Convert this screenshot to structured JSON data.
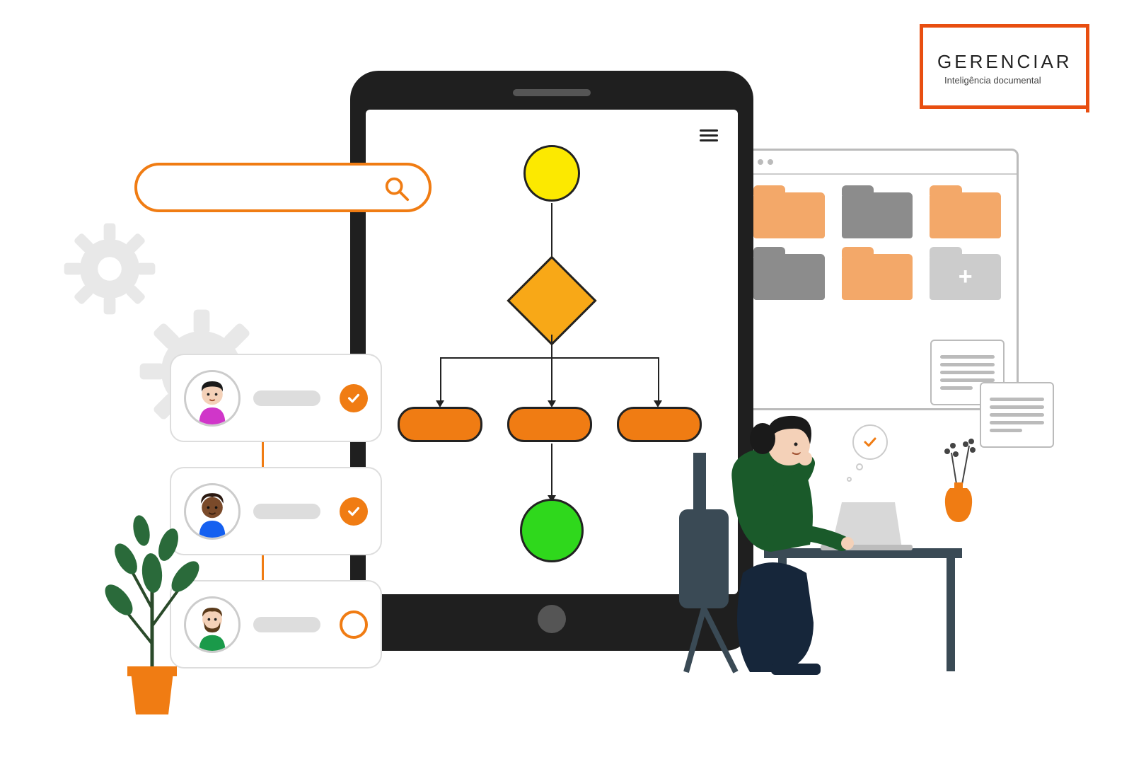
{
  "logo": {
    "title": "GERENCIAR",
    "subtitle": "Inteligência documental"
  },
  "colors": {
    "accent": "#F07C13",
    "brand_border": "#E84E10"
  },
  "illustration": {
    "flowchart_nodes": [
      "start",
      "decision",
      "process-1",
      "process-2",
      "process-3",
      "end"
    ],
    "user_cards": [
      {
        "id": 1,
        "status": "done"
      },
      {
        "id": 2,
        "status": "done"
      },
      {
        "id": 3,
        "status": "pending"
      }
    ],
    "folders_grid": [
      "orange",
      "grey",
      "orange",
      "grey",
      "orange",
      "add"
    ]
  }
}
